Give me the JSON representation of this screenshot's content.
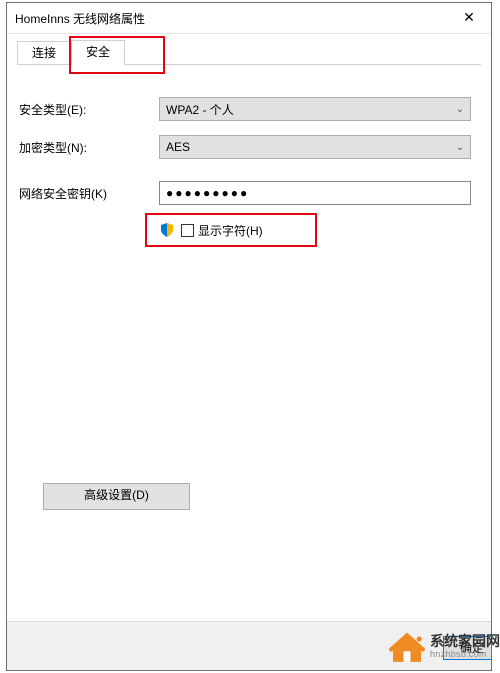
{
  "window": {
    "title": "HomeInns 无线网络属性",
    "close_glyph": "✕"
  },
  "tabs": {
    "connect": "连接",
    "security": "安全"
  },
  "form": {
    "security_type_label": "安全类型(E):",
    "security_type_value": "WPA2 - 个人",
    "encryption_label": "加密类型(N):",
    "encryption_value": "AES",
    "key_label": "网络安全密钥(K)",
    "key_value": "●●●●●●●●●",
    "show_chars_label": "显示字符(H)"
  },
  "buttons": {
    "advanced": "高级设置(D)",
    "ok": "确定"
  },
  "watermark": {
    "cn": "系统家园网",
    "en": "hnzhbsb.com"
  }
}
